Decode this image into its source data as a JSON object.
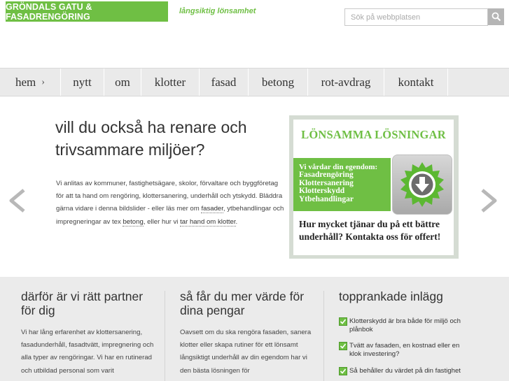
{
  "header": {
    "brand": "GRÖNDALS GATU & FASADRENGÖRING",
    "tagline": "långsiktig lönsamhet",
    "search_placeholder": "Sök på webbplatsen"
  },
  "nav": {
    "items": [
      {
        "label": "hem",
        "has_chevron": true
      },
      {
        "label": "nytt"
      },
      {
        "label": "om"
      },
      {
        "label": "klotter"
      },
      {
        "label": "fasad"
      },
      {
        "label": "betong"
      },
      {
        "label": "rot-avdrag"
      },
      {
        "label": "kontakt"
      }
    ],
    "chevron": "›"
  },
  "hero": {
    "title": "vill du också ha renare och trivsammare miljöer?",
    "text_part1": "Vi anlitas av kommuner, fastighetsägare, skolor, förvaltare och byggföretag för att ta hand om rengöring, klottersanering, underhåll och ytskydd. Bläddra gärna vidare i denna bildslider - eller läs mer om",
    "link_fasader": "fasader",
    "text_part2": ", ytbehandlingar och impregneringar av tex",
    "link_betong": "betong",
    "text_part3": ", eller hur vi",
    "link_klotter": "tar hand om klotter",
    "text_part4": "."
  },
  "promo": {
    "heading": "LÖNSAMMA LÖSNINGAR",
    "lead": "Vi vårdar din egendom:",
    "services": [
      "Fasadrengöring",
      "Klottersanering",
      "Klotterskydd",
      "Ytbehandlingar"
    ],
    "question": "Hur mycket tjänar du på ett bättre underhåll? Kontakta oss för offert!"
  },
  "columns": [
    {
      "title": "därför är vi rätt partner för dig",
      "text": "Vi har lång erfarenhet av klottersanering, fasadunderhåll, fasadtvätt, impregnering och alla typer av rengöringar. Vi har en rutinerad och utbildad personal som varit"
    },
    {
      "title": "så får du mer värde för dina pengar",
      "text": "Oavsett om du ska rengöra fasaden, sanera klotter eller skapa rutiner för ett lönsamt långsiktigt underhåll av din egendom har vi den bästa lösningen för"
    },
    {
      "title": "topprankade inlägg",
      "posts": [
        "Klotterskydd är bra både för miljö och plånbok",
        "Tvätt av fasaden, en kostnad eller en klok investering?",
        "Så behåller du värdet på din fastighet"
      ]
    }
  ],
  "colors": {
    "brand_green": "#6fbf44",
    "nav_bg": "#eaeaea",
    "lower_bg": "#ebebeb",
    "promo_frame": "#d5dcd3"
  }
}
